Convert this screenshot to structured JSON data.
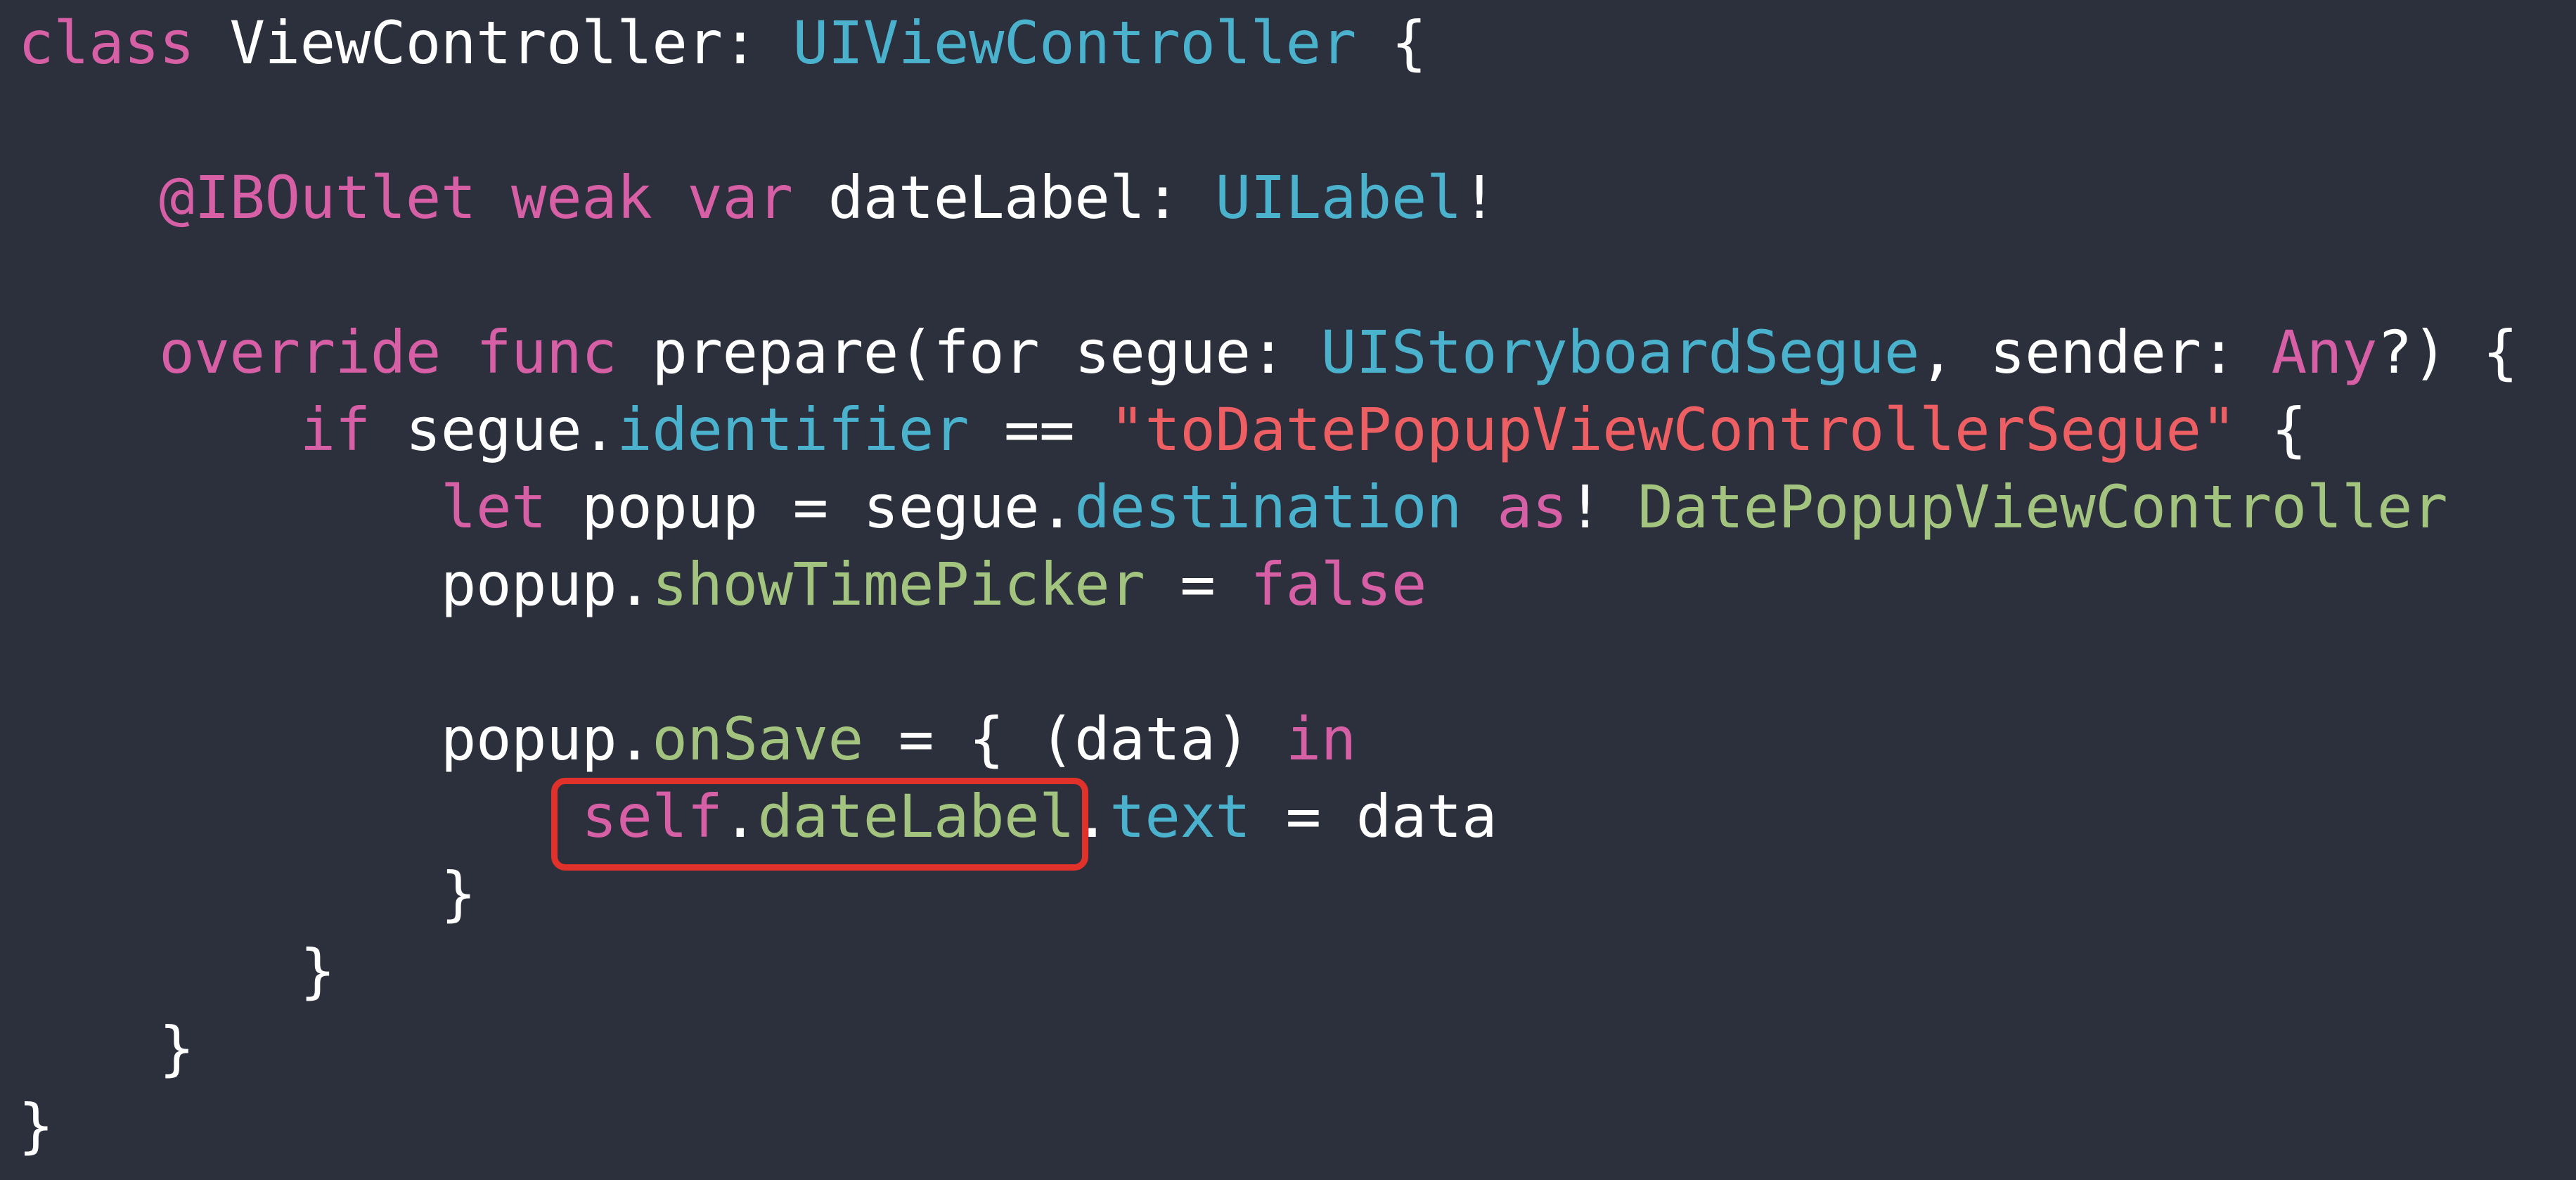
{
  "code": {
    "lines": [
      [
        {
          "text": "class",
          "role": "kw"
        },
        {
          "text": " ViewController: ",
          "role": "plain"
        },
        {
          "text": "UIViewController",
          "role": "type"
        },
        {
          "text": " {",
          "role": "plain"
        }
      ],
      [],
      [
        {
          "text": "    ",
          "role": "plain"
        },
        {
          "text": "@IBOutlet",
          "role": "kw"
        },
        {
          "text": " ",
          "role": "plain"
        },
        {
          "text": "weak",
          "role": "kw"
        },
        {
          "text": " ",
          "role": "plain"
        },
        {
          "text": "var",
          "role": "kw"
        },
        {
          "text": " dateLabel: ",
          "role": "plain"
        },
        {
          "text": "UILabel",
          "role": "type"
        },
        {
          "text": "!",
          "role": "plain"
        }
      ],
      [],
      [
        {
          "text": "    ",
          "role": "plain"
        },
        {
          "text": "override",
          "role": "kw"
        },
        {
          "text": " ",
          "role": "plain"
        },
        {
          "text": "func",
          "role": "kw"
        },
        {
          "text": " prepare(for segue: ",
          "role": "plain"
        },
        {
          "text": "UIStoryboardSegue",
          "role": "type"
        },
        {
          "text": ", sender: ",
          "role": "plain"
        },
        {
          "text": "Any",
          "role": "kw"
        },
        {
          "text": "?) {",
          "role": "plain"
        }
      ],
      [
        {
          "text": "        ",
          "role": "plain"
        },
        {
          "text": "if",
          "role": "kw"
        },
        {
          "text": " segue.",
          "role": "plain"
        },
        {
          "text": "identifier",
          "role": "type"
        },
        {
          "text": " == ",
          "role": "plain"
        },
        {
          "text": "\"toDatePopupViewControllerSegue\"",
          "role": "str"
        },
        {
          "text": " {",
          "role": "plain"
        }
      ],
      [
        {
          "text": "            ",
          "role": "plain"
        },
        {
          "text": "let",
          "role": "kw"
        },
        {
          "text": " popup = segue.",
          "role": "plain"
        },
        {
          "text": "destination",
          "role": "type"
        },
        {
          "text": " ",
          "role": "plain"
        },
        {
          "text": "as",
          "role": "kw"
        },
        {
          "text": "! ",
          "role": "plain"
        },
        {
          "text": "DatePopupViewController",
          "role": "prop"
        }
      ],
      [
        {
          "text": "            popup.",
          "role": "plain"
        },
        {
          "text": "showTimePicker",
          "role": "prop"
        },
        {
          "text": " = ",
          "role": "plain"
        },
        {
          "text": "false",
          "role": "kw"
        }
      ],
      [],
      [
        {
          "text": "            popup.",
          "role": "plain"
        },
        {
          "text": "onSave",
          "role": "prop"
        },
        {
          "text": " = { (data) ",
          "role": "plain"
        },
        {
          "text": "in",
          "role": "kw"
        }
      ],
      [
        {
          "text": "                ",
          "role": "plain"
        },
        {
          "text": "self",
          "role": "kw"
        },
        {
          "text": ".",
          "role": "plain"
        },
        {
          "text": "dateLabel",
          "role": "prop"
        },
        {
          "text": ".",
          "role": "plain"
        },
        {
          "text": "text",
          "role": "type"
        },
        {
          "text": " = data",
          "role": "plain"
        }
      ],
      [
        {
          "text": "            }",
          "role": "plain"
        }
      ],
      [
        {
          "text": "        }",
          "role": "plain"
        }
      ],
      [
        {
          "text": "    }",
          "role": "plain"
        }
      ],
      [
        {
          "text": "}",
          "role": "plain"
        }
      ]
    ]
  },
  "colors": {
    "background": "#2c303c",
    "plain": "#ffffff",
    "keyword": "#d65fa6",
    "type": "#4bb2ce",
    "property": "#a3c47e",
    "string": "#ee5f63",
    "highlight_border": "#e0312b"
  }
}
